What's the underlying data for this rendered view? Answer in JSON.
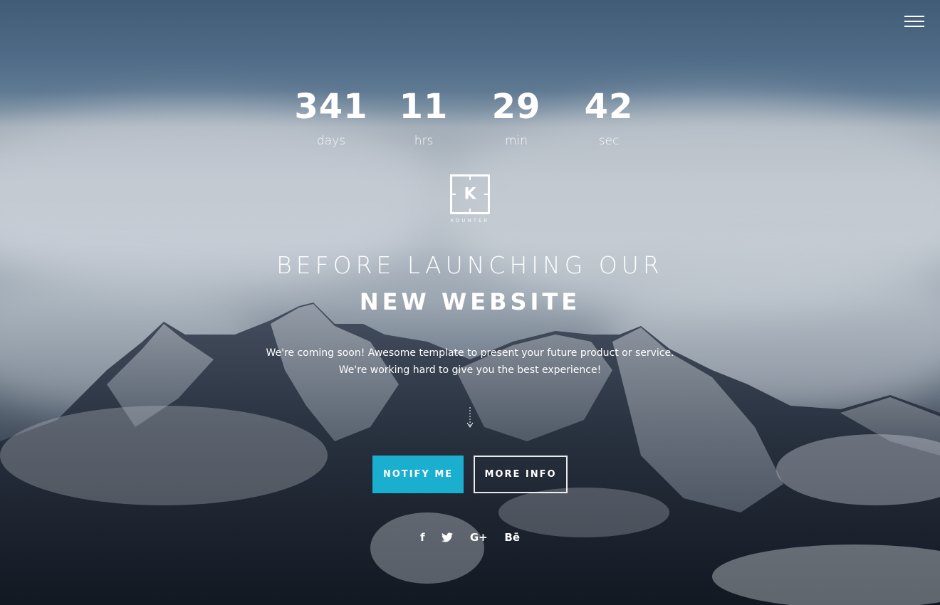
{
  "countdown": [
    {
      "value": "341",
      "label": "days"
    },
    {
      "value": "11",
      "label": "hrs"
    },
    {
      "value": "29",
      "label": "min"
    },
    {
      "value": "42",
      "label": "sec"
    }
  ],
  "logo": {
    "letter": "K",
    "text": "KOUNTER"
  },
  "headline": {
    "line1": "BEFORE LAUNCHING OUR",
    "line2": "NEW WEBSITE"
  },
  "subtitle": {
    "line1": "We're coming soon! Awesome template to present your future product or service.",
    "line2": "We're working hard to give you the best experience!"
  },
  "buttons": {
    "notify": "NOTIFY ME",
    "more_info": "MORE INFO"
  },
  "social": [
    {
      "icon": "facebook-icon",
      "glyph": "f"
    },
    {
      "icon": "twitter-icon",
      "glyph": "🐦"
    },
    {
      "icon": "google-plus-icon",
      "glyph": "G+"
    },
    {
      "icon": "behance-icon",
      "glyph": "Bē"
    }
  ],
  "colors": {
    "accent": "#1aaecf",
    "text": "#ffffff"
  },
  "icons": {
    "menu": "menu-icon",
    "scroll": "arrow-down-icon"
  }
}
